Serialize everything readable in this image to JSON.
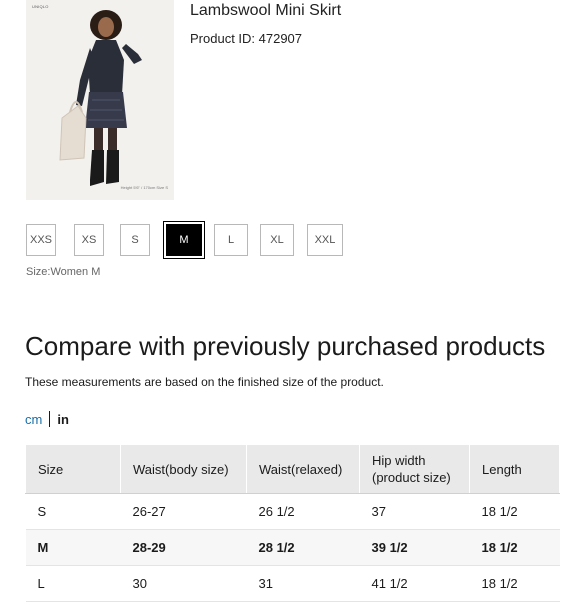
{
  "product": {
    "title": "Lambswool Mini Skirt",
    "id_label": "Product ID: 472907",
    "image_brand": "UNIQLO",
    "image_note": "Height 5'6\" / 170cm  Size S"
  },
  "sizes": {
    "options": [
      "XXS",
      "XS",
      "S",
      "M",
      "L",
      "XL",
      "XXL"
    ],
    "selected": "M",
    "caption": "Size:Women M"
  },
  "compare": {
    "heading": "Compare with previously purchased products",
    "subheading": "These measurements are based on the finished size of the product.",
    "unit_cm": "cm",
    "unit_in": "in"
  },
  "table": {
    "headers": [
      "Size",
      "Waist(body size)",
      "Waist(relaxed)",
      "Hip width\n(product size)",
      "Length"
    ],
    "rows": [
      [
        "S",
        "26-27",
        "26 1/2",
        "37",
        "18 1/2"
      ],
      [
        "M",
        "28-29",
        "28 1/2",
        "39 1/2",
        "18 1/2"
      ],
      [
        "L",
        "30",
        "31",
        "41 1/2",
        "18 1/2"
      ]
    ]
  }
}
